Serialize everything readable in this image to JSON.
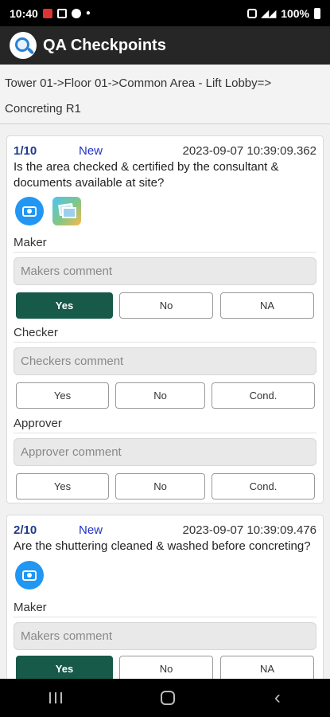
{
  "status_bar": {
    "time": "10:40",
    "battery": "100%"
  },
  "app": {
    "title": "QA Checkpoints",
    "breadcrumb": "Tower 01->Floor 01->Common Area - Lift Lobby=> Concreting R1"
  },
  "checkpoints": [
    {
      "number": "1/10",
      "status": "New",
      "timestamp": "2023-09-07 10:39:09.362",
      "question": "Is the area checked & certified by the consultant & documents available at site?",
      "maker": {
        "label": "Maker",
        "placeholder": "Makers comment",
        "buttons": [
          "Yes",
          "No",
          "NA"
        ],
        "selected": "Yes"
      },
      "checker": {
        "label": "Checker",
        "placeholder": "Checkers comment",
        "buttons": [
          "Yes",
          "No",
          "Cond."
        ]
      },
      "approver": {
        "label": "Approver",
        "placeholder": "Approver comment",
        "buttons": [
          "Yes",
          "No",
          "Cond."
        ]
      }
    },
    {
      "number": "2/10",
      "status": "New",
      "timestamp": "2023-09-07 10:39:09.476",
      "question": "Are the shuttering cleaned & washed before concreting?",
      "maker": {
        "label": "Maker",
        "placeholder": "Makers comment",
        "buttons": [
          "Yes",
          "No",
          "NA"
        ],
        "selected": "Yes"
      }
    }
  ],
  "colors": {
    "selected_button": "#175a4a",
    "camera_button": "#2196f3",
    "checkpoint_number": "#1e3a8a",
    "status_text": "#2231c9"
  }
}
